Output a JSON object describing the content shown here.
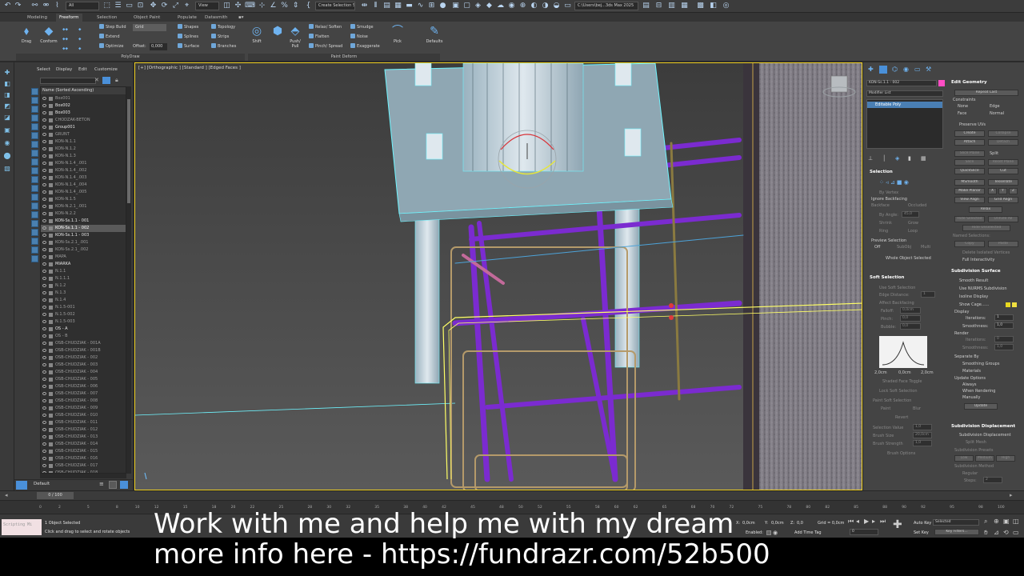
{
  "toolbar": {
    "filter_select": "All",
    "view_select": "View",
    "selection_set": "Create Selection Se",
    "path": "C:\\Users\\bej...3ds Max 2025"
  },
  "ribbon_tabs": [
    {
      "label": "Modeling",
      "active": false
    },
    {
      "label": "Freeform",
      "active": true
    },
    {
      "label": "Selection",
      "active": false
    },
    {
      "label": "Object Paint",
      "active": false
    },
    {
      "label": "Populate",
      "active": false
    },
    {
      "label": "Datasmith",
      "active": false
    }
  ],
  "ribbon": {
    "drag": "Drag",
    "conform": "Conform",
    "step_build": "Step Build",
    "extend": "Extend",
    "optimize": "Optimize",
    "grid": "Grid",
    "offset_label": "Offset:",
    "offset_value": "0,000",
    "shapes": "Shapes",
    "splines": "Splines",
    "surface": "Surface",
    "topology": "Topology",
    "strips": "Strips",
    "branches": "Branches",
    "shift": "Shift",
    "relax_soften": "Relax/ Soften",
    "flatten": "Flatten",
    "pinch_spread": "Pinch/ Spread",
    "smudge": "Smudge",
    "noise": "Noise",
    "exaggerate": "Exaggerate",
    "push_pull": "Push/ Pull",
    "pick": "Pick",
    "defaults": "Defaults",
    "polydraw": "PolyDraw",
    "paint_deform": "Paint Deform"
  },
  "scene_explorer": {
    "menu": [
      "Select",
      "Display",
      "Edit",
      "Customize"
    ],
    "header": "Name (Sorted Ascending)",
    "rows": [
      {
        "name": "Box001",
        "state": "dim"
      },
      {
        "name": "Box002",
        "state": "bright"
      },
      {
        "name": "Box003",
        "state": "bright"
      },
      {
        "name": "CHODZAK-BETON",
        "state": "dim"
      },
      {
        "name": "Group001",
        "state": "bright"
      },
      {
        "name": "GRUNT",
        "state": "dim"
      },
      {
        "name": "KON-N.1.1",
        "state": "dim"
      },
      {
        "name": "KON-N.1.2",
        "state": "dim"
      },
      {
        "name": "KON-N.1.3",
        "state": "dim"
      },
      {
        "name": "KON-N.1.4_.001",
        "state": "dim"
      },
      {
        "name": "KON-N.1.4_.002",
        "state": "dim"
      },
      {
        "name": "KON-N.1.4_.003",
        "state": "dim"
      },
      {
        "name": "KON-N.1.4_.004",
        "state": "dim"
      },
      {
        "name": "KON-N.1.4_.005",
        "state": "dim"
      },
      {
        "name": "KON-N.1.5",
        "state": "dim"
      },
      {
        "name": "KON-N.2.1_.001",
        "state": "dim"
      },
      {
        "name": "KON-N.2.2",
        "state": "dim"
      },
      {
        "name": "KON-Ss.1.1 - 001",
        "state": "bright"
      },
      {
        "name": "KON-Ss.1.1 - 002",
        "state": "selected"
      },
      {
        "name": "KON-Ss.1.1 - 003",
        "state": "bright"
      },
      {
        "name": "KON-Ss.2.1_.001",
        "state": "dim"
      },
      {
        "name": "KON-Ss.2.1_.002",
        "state": "dim"
      },
      {
        "name": "MAPA",
        "state": "dim"
      },
      {
        "name": "MIARKA",
        "state": "bright"
      },
      {
        "name": "N.1.1",
        "state": "dim"
      },
      {
        "name": "N.1.1.1",
        "state": "dim"
      },
      {
        "name": "N.1.2",
        "state": "dim"
      },
      {
        "name": "N.1.3",
        "state": "dim"
      },
      {
        "name": "N.1.4",
        "state": "dim"
      },
      {
        "name": "N.1.5-001",
        "state": "dim"
      },
      {
        "name": "N.1.5-002",
        "state": "dim"
      },
      {
        "name": "N.1.5-003",
        "state": "dim"
      },
      {
        "name": "OS - A",
        "state": "bright"
      },
      {
        "name": "OS - B",
        "state": "dim"
      },
      {
        "name": "OSB-CHUDZIAK - 001A",
        "state": "dim"
      },
      {
        "name": "OSB-CHUDZIAK - 001B",
        "state": "dim"
      },
      {
        "name": "OSB-CHUDZIAK - 002",
        "state": "dim"
      },
      {
        "name": "OSB-CHUDZIAK - 003",
        "state": "dim"
      },
      {
        "name": "OSB-CHUDZIAK - 004",
        "state": "dim"
      },
      {
        "name": "OSB-CHUDZIAK - 005",
        "state": "dim"
      },
      {
        "name": "OSB-CHUDZIAK - 006",
        "state": "dim"
      },
      {
        "name": "OSB-CHUDZIAK - 007",
        "state": "dim"
      },
      {
        "name": "OSB-CHUDZIAK - 008",
        "state": "dim"
      },
      {
        "name": "OSB-CHUDZIAK - 009",
        "state": "dim"
      },
      {
        "name": "OSB-CHUDZIAK - 010",
        "state": "dim"
      },
      {
        "name": "OSB-CHUDZIAK - 011",
        "state": "dim"
      },
      {
        "name": "OSB-CHUDZIAK - 012",
        "state": "dim"
      },
      {
        "name": "OSB-CHUDZIAK - 013",
        "state": "dim"
      },
      {
        "name": "OSB-CHUDZIAK - 014",
        "state": "dim"
      },
      {
        "name": "OSB-CHUDZIAK - 015",
        "state": "dim"
      },
      {
        "name": "OSB-CHUDZIAK - 016",
        "state": "dim"
      },
      {
        "name": "OSB-CHUDZIAK - 017",
        "state": "dim"
      },
      {
        "name": "OSB-CHUDZIAK - 018",
        "state": "dim"
      }
    ],
    "layer": "Default"
  },
  "viewport": {
    "label": "[+] [Orthographic ] [Standard ] [Edged Faces ]"
  },
  "command_panel": {
    "object_name": "KON-Ss.1.1 - 002",
    "modifier_list": "Modifier List",
    "modifier": "Editable Poly",
    "edit_geometry": {
      "title": "Edit Geometry",
      "repeat_last": "Repeat Last",
      "constraints": "Constraints",
      "none": "None",
      "edge": "Edge",
      "face": "Face",
      "normal": "Normal",
      "preserve_uvs": "Preserve UVs",
      "create": "Create",
      "collapse": "Collapse",
      "attach": "Attach",
      "detach": "Detach",
      "slice_plane": "Slice Plane",
      "split": "Split",
      "slice": "Slice",
      "reset_plane": "Reset Plane",
      "quickslice": "QuickSlice",
      "cut": "Cut",
      "msmooth": "MSmooth",
      "tessellate": "Tessellate",
      "make_planar": "Make Planar",
      "x": "X",
      "y": "Y",
      "z": "Z",
      "view_align": "View Align",
      "grid_align": "Grid Align",
      "relax": "Relax",
      "hide_selected": "Hide Selected",
      "unhide_all": "Unhide All",
      "hide_unselected": "Hide Unselected",
      "named_selections": "Named Selections:",
      "copy": "Copy",
      "paste": "Paste",
      "delete_isolated": "Delete Isolated Vertices",
      "full_interactivity": "Full Interactivity"
    },
    "selection": {
      "title": "Selection",
      "by_vertex": "By Vertex",
      "ignore_backfacing": "Ignore Backfacing",
      "by_angle": "By Angle:",
      "angle_value": "45,0",
      "shrink": "Shrink",
      "grow": "Grow",
      "ring": "Ring",
      "loop": "Loop",
      "optional_culling": "Optional Culling",
      "backface": "Backface",
      "occluded": "Occluded",
      "preview_selection": "Preview Selection",
      "off": "Off",
      "subobj": "SubObj",
      "multi": "Multi",
      "whole_object": "Whole Object Selected"
    },
    "soft_selection": {
      "title": "Soft Selection",
      "use_soft": "Use Soft Selection",
      "edge_distance": "Edge Distance:",
      "edge_value": "1",
      "affect_backfacing": "Affect Backfacing",
      "falloff": "Falloff:",
      "falloff_value": "0,0cm",
      "pinch": "Pinch:",
      "pinch_value": "0,0",
      "bubble": "Bubble:",
      "bubble_value": "0,0",
      "curve_left": "2,0cm",
      "curve_mid": "0,0cm",
      "curve_right": "2,0cm",
      "shaded_toggle": "Shaded Face Toggle",
      "lock_soft": "Lock Soft Selection",
      "paint_soft": "Paint Soft Selection",
      "paint": "Paint",
      "blur": "Blur",
      "revert": "Revert",
      "selection_value": "Selection Value",
      "sel_value": "1,0",
      "brush_size": "Brush Size",
      "brush_size_value": "20,0cm",
      "brush_strength": "Brush Strength",
      "brush_strength_value": "1,0",
      "brush_options": "Brush Options"
    },
    "subdivision_surface": {
      "title": "Subdivision Surface",
      "smooth_result": "Smooth Result",
      "use_nurms": "Use NURMS Subdivision",
      "isoline_display": "Isoline Display",
      "show_cage": "Show Cage......",
      "display": "Display",
      "iterations": "Iterations:",
      "iterations_value": "1",
      "smoothness": "Smoothness:",
      "smoothness_value": "1,0",
      "render": "Render",
      "r_iterations": "Iterations:",
      "r_iterations_value": "0",
      "r_smoothness": "Smoothness:",
      "r_smoothness_value": "1,0",
      "separate_by": "Separate By",
      "smoothing_groups": "Smoothing Groups",
      "materials": "Materials",
      "update_options": "Update Options",
      "always": "Always",
      "when_rendering": "When Rendering",
      "manually": "Manually",
      "update": "Update"
    },
    "subdivision_displacement": {
      "title": "Subdivision Displacement",
      "subdivision_displacement": "Subdivision Displacement",
      "split_mesh": "Split Mesh",
      "presets": "Subdivision Presets",
      "low": "Low",
      "medium": "Medium",
      "high": "High",
      "method": "Subdivision Method",
      "regular": "Regular",
      "steps": "Steps:",
      "steps_value": "2"
    }
  },
  "timeline": {
    "frame": "0 / 100",
    "ticks": [
      "0",
      "2",
      "5",
      "8",
      "10",
      "12",
      "15",
      "18",
      "20",
      "22",
      "25",
      "28",
      "30",
      "32",
      "35",
      "38",
      "40",
      "42",
      "45",
      "48",
      "50",
      "52",
      "55",
      "58",
      "60",
      "62",
      "65",
      "68",
      "70",
      "72",
      "75",
      "78",
      "80",
      "82",
      "85",
      "88",
      "90",
      "92",
      "95",
      "98",
      "100"
    ]
  },
  "status": {
    "maxscript": "Scripting Mi",
    "selected": "1 Object Selected",
    "hint": "Click and drag to select and rotate objects",
    "x_label": "X:",
    "x_value": "0,0cm",
    "y_label": "Y:",
    "y_value": "0,0cm",
    "z_label": "Z:",
    "z_value": "0,0",
    "grid": "Grid = 0,0cm",
    "enabled": "Enabled:",
    "add_time_tag": "Add Time Tag",
    "auto_key": "Auto Key",
    "set_key": "Set Key",
    "selected_option": "Selected",
    "key_filters": "Key Filters...",
    "frame_value": "0"
  },
  "caption": {
    "line1": "Work with me and help me with my dream",
    "line2": "more info here - https://fundrazr.com/52b500"
  },
  "colors": {
    "accent": "#f0d020",
    "rebar_purple": "#7b2bd0",
    "cyan_wire": "#6ff5ff",
    "swatch_pink": "#ff4dc4"
  }
}
